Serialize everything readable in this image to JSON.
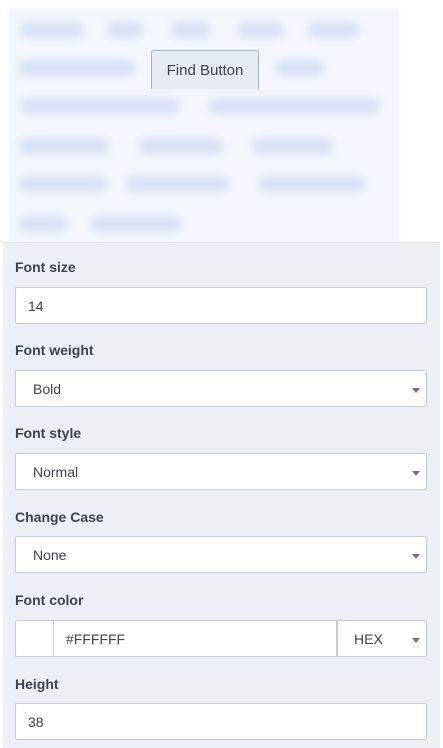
{
  "preview": {
    "tab_label": "Find Button"
  },
  "settings": {
    "font_size": {
      "label": "Font size",
      "value": "14"
    },
    "font_weight": {
      "label": "Font weight",
      "value": "Bold"
    },
    "font_style": {
      "label": "Font style",
      "value": "Normal"
    },
    "change_case": {
      "label": "Change Case",
      "value": "None"
    },
    "font_color": {
      "label": "Font color",
      "value": "#FFFFFF",
      "swatch": "#FFFFFF",
      "format": "HEX"
    },
    "height": {
      "label": "Height",
      "value": "38"
    }
  },
  "icons": {
    "dropdown": "chevron-down-icon"
  }
}
